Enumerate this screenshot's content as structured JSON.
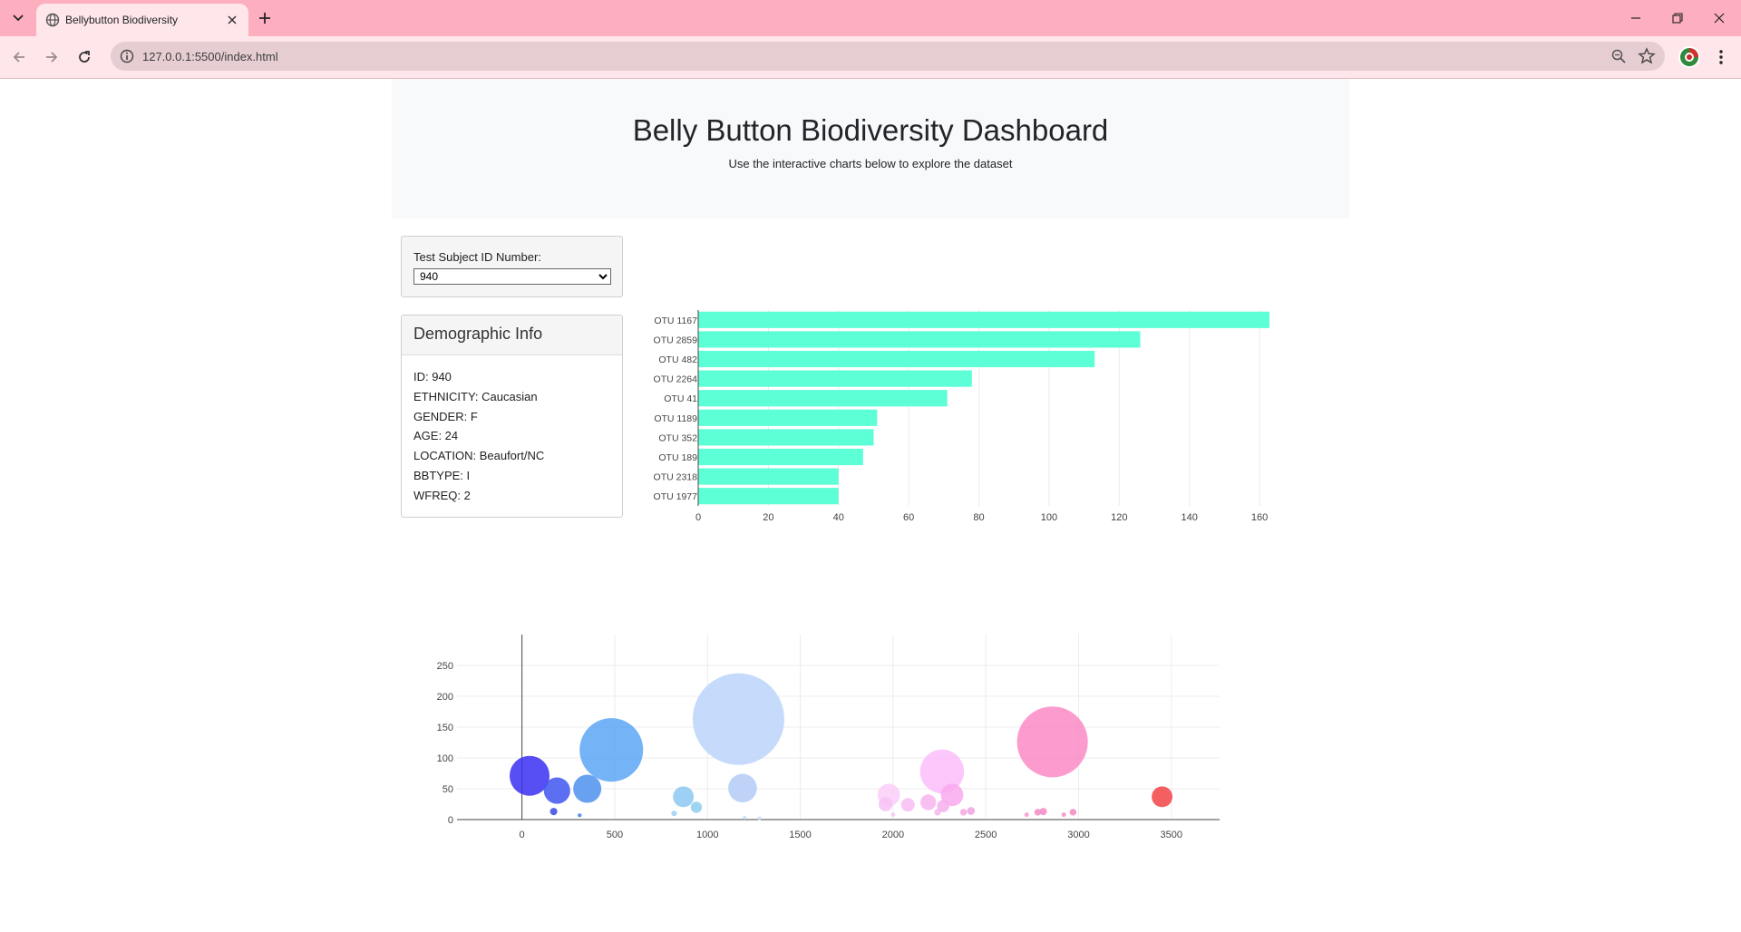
{
  "browser": {
    "tab_title": "Bellybutton Biodiversity",
    "url": "127.0.0.1:5500/index.html"
  },
  "page": {
    "title": "Belly Button Biodiversity Dashboard",
    "subtitle": "Use the interactive charts below to explore the dataset"
  },
  "selector": {
    "label": "Test Subject ID Number:",
    "selected": "940"
  },
  "demographics": {
    "heading": "Demographic Info",
    "lines": [
      "ID: 940",
      "ETHNICITY: Caucasian",
      "GENDER: F",
      "AGE: 24",
      "LOCATION: Beaufort/NC",
      "BBTYPE: I",
      "WFREQ: 2"
    ]
  },
  "colors": {
    "bar": "#5cffd6",
    "tab_strip": "#fdaebf",
    "toolbar": "#fee6ea"
  },
  "chart_data": [
    {
      "type": "bar",
      "orientation": "horizontal",
      "categories": [
        "OTU 1167",
        "OTU 2859",
        "OTU 482",
        "OTU 2264",
        "OTU 41",
        "OTU 1189",
        "OTU 352",
        "OTU 189",
        "OTU 2318",
        "OTU 1977"
      ],
      "values": [
        163,
        126,
        113,
        78,
        71,
        51,
        50,
        47,
        40,
        40
      ],
      "xlim": [
        0,
        168
      ],
      "xticks": [
        0,
        20,
        40,
        60,
        80,
        100,
        120,
        140,
        160
      ],
      "grid": true
    },
    {
      "type": "scatter",
      "marker": "bubble",
      "xlim": [
        -350,
        3760
      ],
      "ylim": [
        0,
        300
      ],
      "xticks": [
        0,
        500,
        1000,
        1500,
        2000,
        2500,
        3000,
        3500
      ],
      "yticks": [
        0,
        50,
        100,
        150,
        200,
        250
      ],
      "grid": true,
      "points": [
        {
          "x": 41,
          "y": 71,
          "color": "#3a2ff2"
        },
        {
          "x": 189,
          "y": 47,
          "color": "#3f56f0"
        },
        {
          "x": 171,
          "y": 13,
          "color": "#3a45e6"
        },
        {
          "x": 352,
          "y": 50,
          "color": "#4f90ee"
        },
        {
          "x": 311,
          "y": 7,
          "color": "#4a7be8"
        },
        {
          "x": 482,
          "y": 113,
          "color": "#5ba6f4"
        },
        {
          "x": 870,
          "y": 37,
          "color": "#8cc8f2"
        },
        {
          "x": 940,
          "y": 20,
          "color": "#8bcdf0"
        },
        {
          "x": 820,
          "y": 10,
          "color": "#9fd2f4"
        },
        {
          "x": 1167,
          "y": 163,
          "color": "#bcd5fb"
        },
        {
          "x": 1189,
          "y": 51,
          "color": "#b3cbf6"
        },
        {
          "x": 1200,
          "y": 3,
          "color": "#c8d9f8"
        },
        {
          "x": 1280,
          "y": 2,
          "color": "#c8d9f8"
        },
        {
          "x": 1977,
          "y": 40,
          "color": "#fccff9"
        },
        {
          "x": 1960,
          "y": 25,
          "color": "#f6c2f5"
        },
        {
          "x": 2080,
          "y": 24,
          "color": "#f8bcf4"
        },
        {
          "x": 2000,
          "y": 8,
          "color": "#f7c8f5"
        },
        {
          "x": 2264,
          "y": 78,
          "color": "#fcbdfa"
        },
        {
          "x": 2318,
          "y": 40,
          "color": "#f9a9ee"
        },
        {
          "x": 2190,
          "y": 28,
          "color": "#f7b4ef"
        },
        {
          "x": 2270,
          "y": 22,
          "color": "#f5b0ec"
        },
        {
          "x": 2240,
          "y": 12,
          "color": "#f4b8ee"
        },
        {
          "x": 2380,
          "y": 12,
          "color": "#f3a8e3"
        },
        {
          "x": 2420,
          "y": 14,
          "color": "#f0a2e2"
        },
        {
          "x": 2859,
          "y": 126,
          "color": "#fc8bc6"
        },
        {
          "x": 2720,
          "y": 8,
          "color": "#f598cd"
        },
        {
          "x": 2780,
          "y": 12,
          "color": "#f48ac4"
        },
        {
          "x": 2810,
          "y": 13,
          "color": "#f48ac4"
        },
        {
          "x": 2920,
          "y": 8,
          "color": "#f390c4"
        },
        {
          "x": 2970,
          "y": 12,
          "color": "#f38ac0"
        },
        {
          "x": 3450,
          "y": 37,
          "color": "#f24347"
        }
      ],
      "sizes": [
        71,
        47,
        13,
        50,
        7,
        113,
        37,
        20,
        10,
        163,
        51,
        3,
        2,
        40,
        25,
        24,
        8,
        78,
        40,
        28,
        22,
        12,
        12,
        14,
        126,
        8,
        12,
        13,
        8,
        12,
        37
      ]
    }
  ]
}
